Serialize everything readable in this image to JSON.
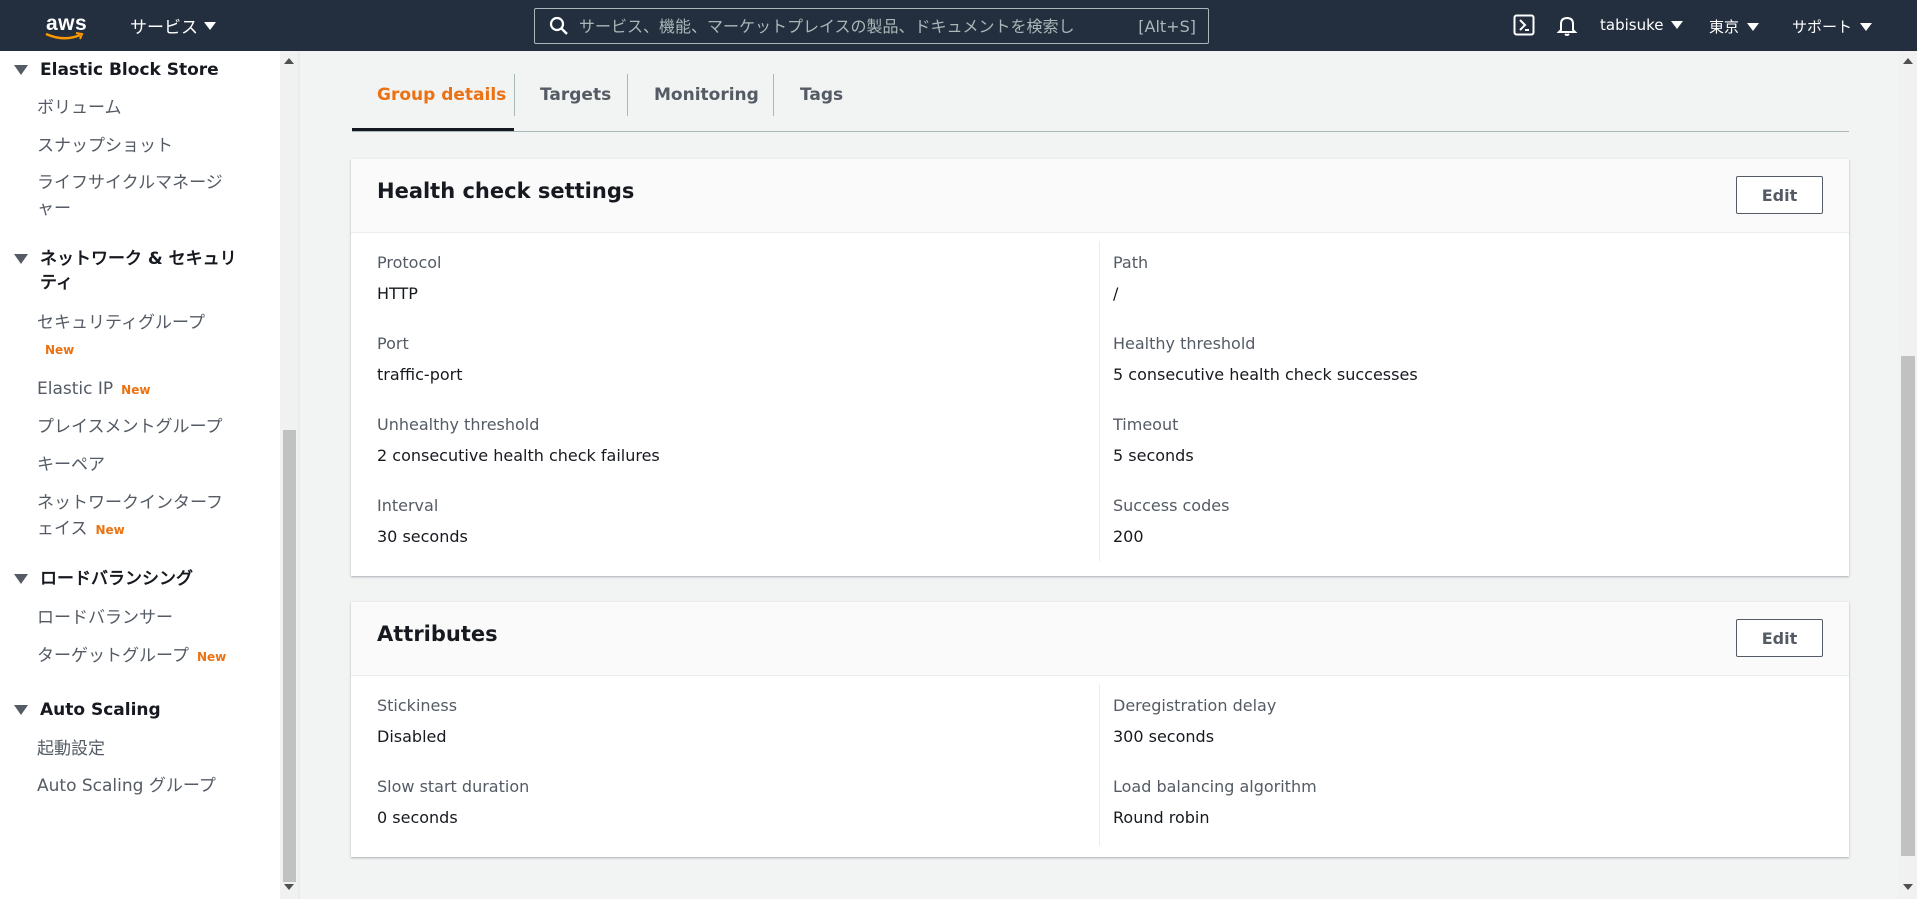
{
  "topnav": {
    "logo_text": "aws",
    "services_label": "サービス",
    "search_placeholder": "サービス、機能、マーケットプレイスの製品、ドキュメントを検索し",
    "search_shortcut": "[Alt+S]",
    "user": "tabisuke",
    "region": "東京",
    "support": "サポート"
  },
  "sidebar": {
    "sections": [
      {
        "title": "Elastic Block Store",
        "items": [
          "ボリューム",
          "スナップショット",
          "ライフサイクルマネージャー"
        ]
      },
      {
        "title": "ネットワーク & セキュリティ",
        "items": [
          "セキュリティグループ",
          "Elastic IP",
          "プレイスメントグループ",
          "キーペア",
          "ネットワークインターフェイス"
        ]
      },
      {
        "title": "ロードバランシング",
        "items": [
          "ロードバランサー",
          "ターゲットグループ"
        ]
      },
      {
        "title": "Auto Scaling",
        "items": [
          "起動設定",
          "Auto Scaling グループ"
        ]
      }
    ],
    "lifecycle_line1": "ライフサイクルマネージ",
    "lifecycle_line2": "ャー",
    "netsec_line1": "ネットワーク & セキュリ",
    "netsec_line2": "ティ",
    "eni_line1": "ネットワークインターフ",
    "eni_line2": "ェイス",
    "new_badge": "New"
  },
  "tabs": [
    {
      "label": "Group details",
      "active": true
    },
    {
      "label": "Targets",
      "active": false
    },
    {
      "label": "Monitoring",
      "active": false
    },
    {
      "label": "Tags",
      "active": false
    }
  ],
  "health_check": {
    "title": "Health check settings",
    "edit_label": "Edit",
    "protocol": {
      "label": "Protocol",
      "value": "HTTP"
    },
    "path": {
      "label": "Path",
      "value": "/"
    },
    "port": {
      "label": "Port",
      "value": "traffic-port"
    },
    "healthy_threshold": {
      "label": "Healthy threshold",
      "value": "5 consecutive health check successes"
    },
    "unhealthy_threshold": {
      "label": "Unhealthy threshold",
      "value": "2 consecutive health check failures"
    },
    "timeout": {
      "label": "Timeout",
      "value": "5 seconds"
    },
    "interval": {
      "label": "Interval",
      "value": "30 seconds"
    },
    "success_codes": {
      "label": "Success codes",
      "value": "200"
    }
  },
  "attributes": {
    "title": "Attributes",
    "edit_label": "Edit",
    "stickiness": {
      "label": "Stickiness",
      "value": "Disabled"
    },
    "deregistration_delay": {
      "label": "Deregistration delay",
      "value": "300 seconds"
    },
    "slow_start": {
      "label": "Slow start duration",
      "value": "0 seconds"
    },
    "algorithm": {
      "label": "Load balancing algorithm",
      "value": "Round robin"
    }
  },
  "colors": {
    "nav_bg": "#232f3e",
    "accent": "#ec7211",
    "text": "#16191f",
    "muted": "#545b64"
  }
}
